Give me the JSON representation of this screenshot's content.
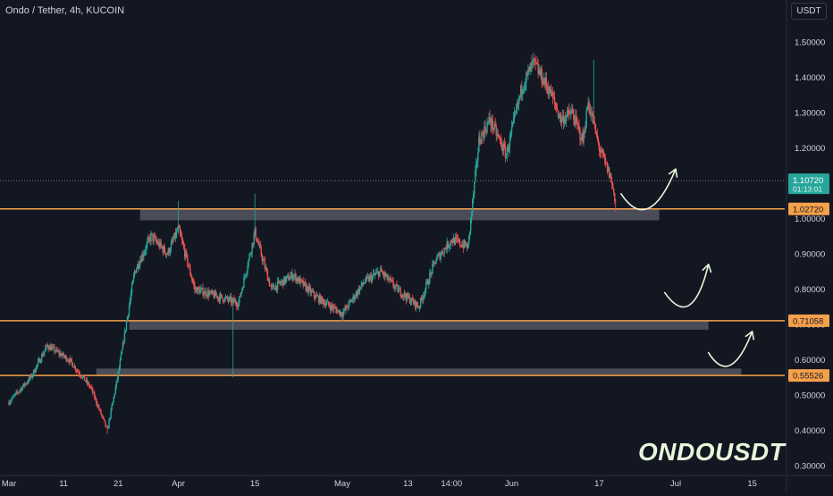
{
  "header": {
    "symbol_line": "Ondo / Tether, 4h, KUCOIN"
  },
  "watermark": "ONDOUSDT",
  "colors": {
    "background": "#131722",
    "up": "#26a69a",
    "down": "#ef5350",
    "level_line": "#f5a04a",
    "zone_fill": "#5d606b",
    "text": "#d1d4dc",
    "current_price_bg": "#26a69a",
    "watermark": "#e9f5db",
    "arrow": "#e9f5db"
  },
  "chart_data": {
    "type": "candlestick",
    "title": "Ondo / Tether, 4h, KUCOIN",
    "y_axis": {
      "unit_label": "USDT",
      "min": 0.28,
      "max": 1.55,
      "ticks": [
        1.5,
        1.4,
        1.3,
        1.2,
        1.1,
        1.0,
        0.9,
        0.8,
        0.7,
        0.6,
        0.5,
        0.4,
        0.3
      ],
      "tick_labels": [
        "1.50000",
        "1.40000",
        "1.30000",
        "1.20000",
        "1.10000",
        "1.00000",
        "0.90000",
        "0.80000",
        "0.70000",
        "0.60000",
        "0.50000",
        "0.40000",
        "0.30000"
      ]
    },
    "x_axis": {
      "start": "2024-03-01",
      "end": "2024-07-17",
      "tick_dates": [
        "2024-03-01",
        "2024-03-11",
        "2024-03-21",
        "2024-04-01",
        "2024-04-15",
        "2024-05-01",
        "2024-05-13",
        "2024-05-21",
        "2024-06-01",
        "2024-06-17",
        "2024-07-01",
        "2024-07-15"
      ],
      "tick_labels": [
        "Mar",
        "11",
        "21",
        "Apr",
        "15",
        "May",
        "13",
        "14:00",
        "Jun",
        "17",
        "Jul",
        "15"
      ]
    },
    "price_path": [
      {
        "date": "2024-03-01",
        "price": 0.48
      },
      {
        "date": "2024-03-05",
        "price": 0.55
      },
      {
        "date": "2024-03-08",
        "price": 0.64
      },
      {
        "date": "2024-03-12",
        "price": 0.6
      },
      {
        "date": "2024-03-16",
        "price": 0.52
      },
      {
        "date": "2024-03-19",
        "price": 0.4
      },
      {
        "date": "2024-03-21",
        "price": 0.56
      },
      {
        "date": "2024-03-24",
        "price": 0.85
      },
      {
        "date": "2024-03-27",
        "price": 0.95
      },
      {
        "date": "2024-03-30",
        "price": 0.9
      },
      {
        "date": "2024-04-01",
        "price": 0.97
      },
      {
        "date": "2024-04-04",
        "price": 0.8
      },
      {
        "date": "2024-04-08",
        "price": 0.78
      },
      {
        "date": "2024-04-12",
        "price": 0.76
      },
      {
        "date": "2024-04-15",
        "price": 0.96
      },
      {
        "date": "2024-04-18",
        "price": 0.8
      },
      {
        "date": "2024-04-22",
        "price": 0.84
      },
      {
        "date": "2024-04-26",
        "price": 0.78
      },
      {
        "date": "2024-05-01",
        "price": 0.73
      },
      {
        "date": "2024-05-05",
        "price": 0.82
      },
      {
        "date": "2024-05-08",
        "price": 0.85
      },
      {
        "date": "2024-05-11",
        "price": 0.8
      },
      {
        "date": "2024-05-15",
        "price": 0.75
      },
      {
        "date": "2024-05-18",
        "price": 0.88
      },
      {
        "date": "2024-05-21",
        "price": 0.94
      },
      {
        "date": "2024-05-24",
        "price": 0.92
      },
      {
        "date": "2024-05-26",
        "price": 1.22
      },
      {
        "date": "2024-05-28",
        "price": 1.28
      },
      {
        "date": "2024-05-31",
        "price": 1.18
      },
      {
        "date": "2024-06-03",
        "price": 1.38
      },
      {
        "date": "2024-06-05",
        "price": 1.44
      },
      {
        "date": "2024-06-08",
        "price": 1.36
      },
      {
        "date": "2024-06-10",
        "price": 1.28
      },
      {
        "date": "2024-06-12",
        "price": 1.3
      },
      {
        "date": "2024-06-14",
        "price": 1.22
      },
      {
        "date": "2024-06-15",
        "price": 1.33
      },
      {
        "date": "2024-06-17",
        "price": 1.2
      },
      {
        "date": "2024-06-19",
        "price": 1.12
      },
      {
        "date": "2024-06-20",
        "price": 1.05
      }
    ],
    "wick_spikes": [
      {
        "date": "2024-04-15",
        "high": 1.07
      },
      {
        "date": "2024-04-01",
        "high": 1.05
      },
      {
        "date": "2024-06-05",
        "high": 1.47
      },
      {
        "date": "2024-06-16",
        "high": 1.45
      },
      {
        "date": "2024-04-11",
        "low": 0.55
      },
      {
        "date": "2024-03-19",
        "low": 0.39
      },
      {
        "date": "2024-06-20",
        "low": 1.02
      }
    ],
    "current_price": {
      "value": 1.1072,
      "label": "1.10720",
      "countdown": "01:13:01"
    },
    "horizontal_levels": [
      {
        "value": 1.0272,
        "label": "1.02720"
      },
      {
        "value": 0.71058,
        "label": "0.71058"
      },
      {
        "value": 0.55526,
        "label": "0.55526"
      }
    ],
    "zones": [
      {
        "from": "2024-03-25",
        "to": "2024-06-28",
        "bottom": 0.995,
        "top": 1.027
      },
      {
        "from": "2024-03-23",
        "to": "2024-07-07",
        "bottom": 0.685,
        "top": 0.711
      },
      {
        "from": "2024-03-17",
        "to": "2024-07-13",
        "bottom": 0.555,
        "top": 0.575
      }
    ],
    "arrows": [
      {
        "path": [
          [
            "2024-06-21",
            1.07
          ],
          [
            "2024-06-26",
            0.998
          ],
          [
            "2024-07-01",
            1.14
          ]
        ]
      },
      {
        "path": [
          [
            "2024-06-29",
            0.79
          ],
          [
            "2024-07-04",
            0.725
          ],
          [
            "2024-07-07",
            0.87
          ]
        ]
      },
      {
        "path": [
          [
            "2024-07-07",
            0.62
          ],
          [
            "2024-07-11",
            0.565
          ],
          [
            "2024-07-15",
            0.68
          ]
        ]
      }
    ],
    "grid": false,
    "legend": "none"
  }
}
